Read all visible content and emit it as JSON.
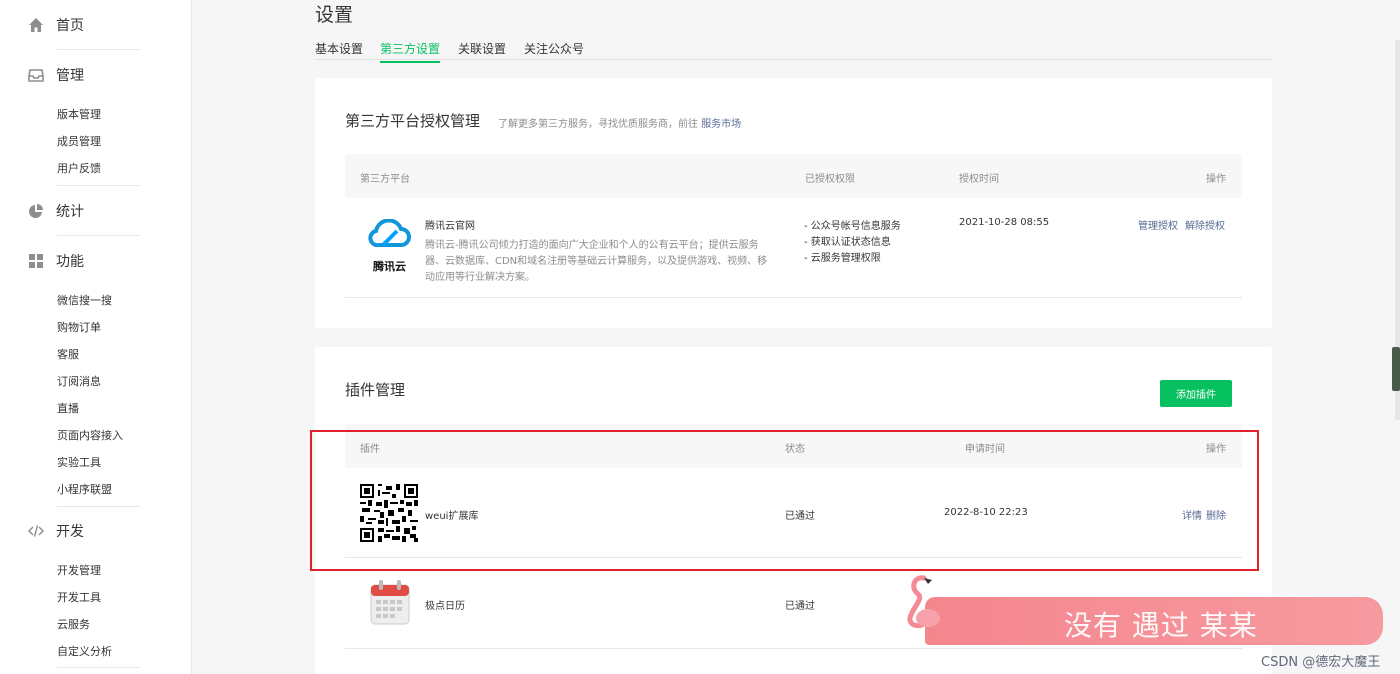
{
  "sidebar": {
    "home": "首页",
    "manage": {
      "title": "管理",
      "items": [
        "版本管理",
        "成员管理",
        "用户反馈"
      ]
    },
    "stats": "统计",
    "features": {
      "title": "功能",
      "items": [
        "微信搜一搜",
        "购物订单",
        "客服",
        "订阅消息",
        "直播",
        "页面内容接入",
        "实验工具",
        "小程序联盟"
      ]
    },
    "dev": {
      "title": "开发",
      "items": [
        "开发管理",
        "开发工具",
        "云服务",
        "自定义分析"
      ]
    }
  },
  "page": {
    "title": "设置",
    "tabs": [
      "基本设置",
      "第三方设置",
      "关联设置",
      "关注公众号"
    ],
    "active_tab": "第三方设置"
  },
  "third_party": {
    "title": "第三方平台授权管理",
    "desc": "了解更多第三方服务，寻找优质服务商，前往",
    "desc_link": "服务市场",
    "columns": [
      "第三方平台",
      "已授权权限",
      "授权时间",
      "操作"
    ],
    "row": {
      "logo_text": "腾讯云",
      "name": "腾讯云官网",
      "desc_lines": [
        "腾讯云-腾讯公司倾力打造的面向广大企业和个人的公有云平台；提供云服务",
        "器、云数据库、CDN和域名注册等基础云计算服务，以及提供游戏、视频、移",
        "动应用等行业解决方案。"
      ],
      "permissions": [
        "- 公众号帐号信息服务",
        "- 获取认证状态信息",
        "- 云服务管理权限"
      ],
      "time": "2021-10-28 08:55",
      "actions": [
        "管理授权",
        "解除授权"
      ]
    }
  },
  "plugins": {
    "title": "插件管理",
    "add_button": "添加插件",
    "columns": [
      "插件",
      "状态",
      "申请时间",
      "操作"
    ],
    "rows": [
      {
        "name": "weui扩展库",
        "status": "已通过",
        "time": "2022-8-10 22:23",
        "actions": [
          "详情",
          "删除"
        ]
      },
      {
        "name": "极点日历",
        "status": "已通过"
      }
    ]
  },
  "overlay": {
    "banner_text": "没有 遇过 某某",
    "watermark": "CSDN @德宏大魔王"
  },
  "colors": {
    "accent": "#07c160",
    "link": "#576b95",
    "highlight": "#e0202a"
  }
}
